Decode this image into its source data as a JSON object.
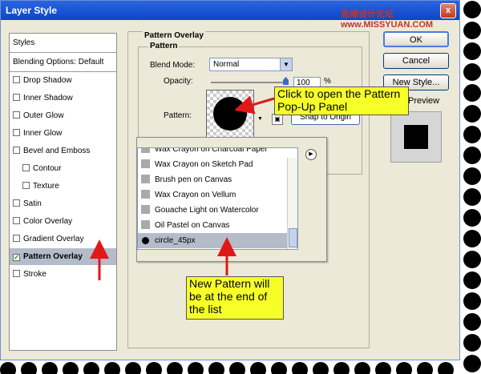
{
  "window": {
    "title": "Layer Style",
    "close_glyph": "x"
  },
  "watermark": "思缘设计论坛 www.MISSYUAN.COM",
  "styles_list": {
    "header": "Styles",
    "blending_options": "Blending Options: Default",
    "items": [
      {
        "label": "Drop Shadow",
        "checked": false,
        "indent": false
      },
      {
        "label": "Inner Shadow",
        "checked": false,
        "indent": false
      },
      {
        "label": "Outer Glow",
        "checked": false,
        "indent": false
      },
      {
        "label": "Inner Glow",
        "checked": false,
        "indent": false
      },
      {
        "label": "Bevel and Emboss",
        "checked": false,
        "indent": false
      },
      {
        "label": "Contour",
        "checked": false,
        "indent": true
      },
      {
        "label": "Texture",
        "checked": false,
        "indent": true
      },
      {
        "label": "Satin",
        "checked": false,
        "indent": false
      },
      {
        "label": "Color Overlay",
        "checked": false,
        "indent": false
      },
      {
        "label": "Gradient Overlay",
        "checked": false,
        "indent": false
      },
      {
        "label": "Pattern Overlay",
        "checked": true,
        "indent": false,
        "selected": true
      },
      {
        "label": "Stroke",
        "checked": false,
        "indent": false
      }
    ]
  },
  "pattern_overlay": {
    "section_title": "Pattern Overlay",
    "sub_title": "Pattern",
    "blend_mode_label": "Blend Mode:",
    "blend_mode_value": "Normal",
    "opacity_label": "Opacity:",
    "opacity_value": "100",
    "opacity_unit": "%",
    "pattern_label": "Pattern:",
    "snap_button": "Snap to Origin"
  },
  "buttons": {
    "ok": "OK",
    "cancel": "Cancel",
    "new_style": "New Style..."
  },
  "preview_label": "Preview",
  "pattern_popup": {
    "rows": [
      "Wax Crayon on Charcoal Paper",
      "Wax Crayon on Sketch Pad",
      "Brush pen on Canvas",
      "Wax Crayon on Vellum",
      "Gouache Light on Watercolor",
      "Oil Pastel on Canvas",
      "circle_45px"
    ],
    "selected_index": 6
  },
  "callouts": {
    "top": "Click to open the Pattern Pop-Up Panel",
    "bottom": "New Pattern will be at the end of the list"
  },
  "colors": {
    "callout": "#f6ff28",
    "arrow": "#e01818",
    "selection": "#b4bcc9",
    "titlebar": "#0b46c8"
  }
}
